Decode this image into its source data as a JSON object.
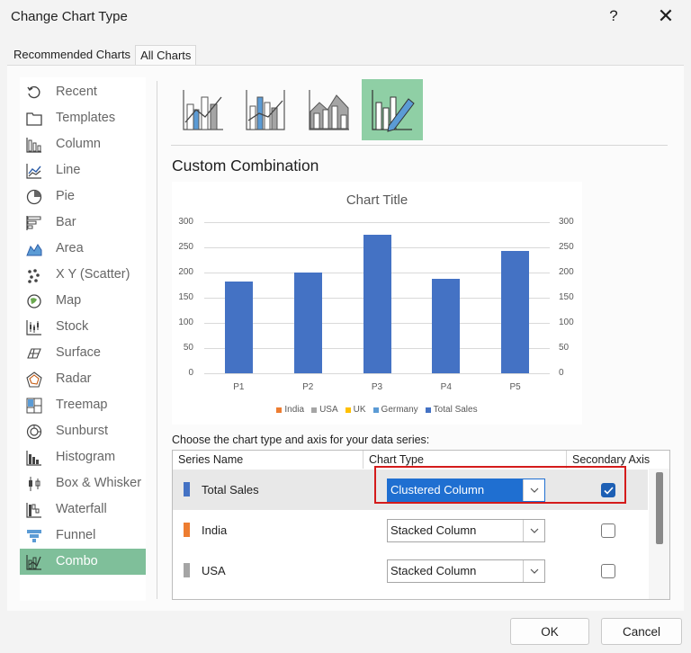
{
  "window": {
    "title": "Change Chart Type",
    "help": "?",
    "close": "✕"
  },
  "tabs": [
    {
      "label": "Recommended Charts"
    },
    {
      "label": "All Charts"
    }
  ],
  "sidebar": {
    "items": [
      {
        "label": "Recent",
        "icon": "recent-icon"
      },
      {
        "label": "Templates",
        "icon": "templates-icon"
      },
      {
        "label": "Column",
        "icon": "column-chart-icon"
      },
      {
        "label": "Line",
        "icon": "line-chart-icon"
      },
      {
        "label": "Pie",
        "icon": "pie-chart-icon"
      },
      {
        "label": "Bar",
        "icon": "bar-chart-icon"
      },
      {
        "label": "Area",
        "icon": "area-chart-icon"
      },
      {
        "label": "X Y (Scatter)",
        "icon": "scatter-chart-icon"
      },
      {
        "label": "Map",
        "icon": "map-chart-icon"
      },
      {
        "label": "Stock",
        "icon": "stock-chart-icon"
      },
      {
        "label": "Surface",
        "icon": "surface-chart-icon"
      },
      {
        "label": "Radar",
        "icon": "radar-chart-icon"
      },
      {
        "label": "Treemap",
        "icon": "treemap-chart-icon"
      },
      {
        "label": "Sunburst",
        "icon": "sunburst-chart-icon"
      },
      {
        "label": "Histogram",
        "icon": "histogram-chart-icon"
      },
      {
        "label": "Box & Whisker",
        "icon": "box-whisker-chart-icon"
      },
      {
        "label": "Waterfall",
        "icon": "waterfall-chart-icon"
      },
      {
        "label": "Funnel",
        "icon": "funnel-chart-icon"
      },
      {
        "label": "Combo",
        "icon": "combo-chart-icon",
        "selected": true
      }
    ]
  },
  "section_title": "Custom Combination",
  "preview": {
    "title": "Chart Title"
  },
  "chart_data": {
    "type": "bar",
    "title": "Chart Title",
    "categories": [
      "P1",
      "P2",
      "P3",
      "P4",
      "P5"
    ],
    "series": [
      {
        "name": "Total Sales",
        "values": [
          182,
          200,
          275,
          188,
          242
        ]
      }
    ],
    "ylim": [
      0,
      300
    ],
    "y_ticks": [
      "300",
      "250",
      "200",
      "150",
      "100",
      "50",
      "0"
    ],
    "secondary_y_ticks": [
      "300",
      "250",
      "200",
      "150",
      "100",
      "50",
      "0"
    ],
    "grid": true,
    "legend_position": "bottom",
    "legend": [
      {
        "name": "India",
        "color": "#ed7d31"
      },
      {
        "name": "USA",
        "color": "#a5a5a5"
      },
      {
        "name": "UK",
        "color": "#ffc000"
      },
      {
        "name": "Germany",
        "color": "#5b9bd5"
      },
      {
        "name": "Total Sales",
        "color": "#4472c4"
      }
    ]
  },
  "instruction": "Choose the chart type and axis for your data series:",
  "series_table": {
    "headers": [
      "Series Name",
      "Chart Type",
      "Secondary Axis"
    ],
    "rows": [
      {
        "name": "Total Sales",
        "color": "#4472c4",
        "chart_type": "Clustered Column",
        "secondary_axis": true,
        "selected": true
      },
      {
        "name": "India",
        "color": "#ed7d31",
        "chart_type": "Stacked Column",
        "secondary_axis": false
      },
      {
        "name": "USA",
        "color": "#a5a5a5",
        "chart_type": "Stacked Column",
        "secondary_axis": false
      }
    ]
  },
  "buttons": {
    "ok": "OK",
    "cancel": "Cancel"
  },
  "colors": {
    "accent": "#1f6fd1",
    "selected_nav": "#7fbf9a",
    "highlight_box": "#d41b1b"
  }
}
